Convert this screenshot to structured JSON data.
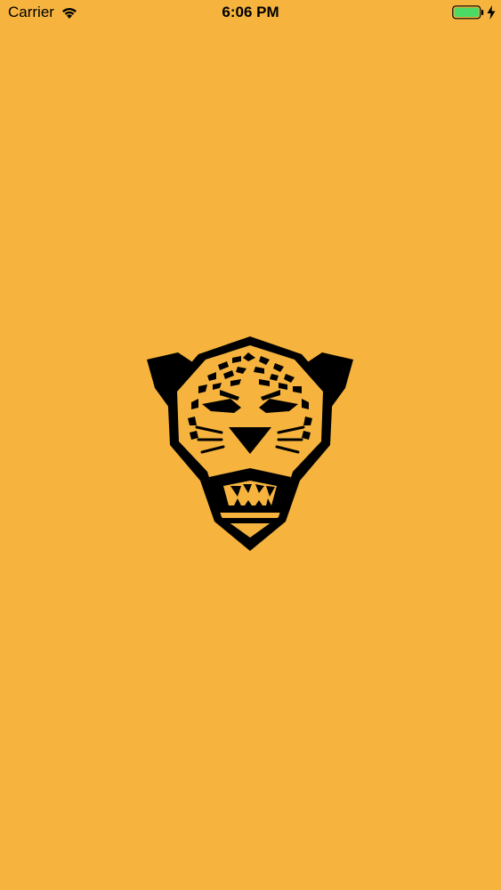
{
  "colors": {
    "background": "#F6B43F",
    "foreground": "#000000",
    "battery_fill": "#4CD964"
  },
  "status_bar": {
    "carrier": "Carrier",
    "time": "6:06 PM",
    "wifi_icon": "wifi-icon",
    "battery_icon": "battery-icon",
    "charging_icon": "lightning-bolt-icon"
  },
  "splash": {
    "logo_icon": "jaguar-head-icon"
  }
}
